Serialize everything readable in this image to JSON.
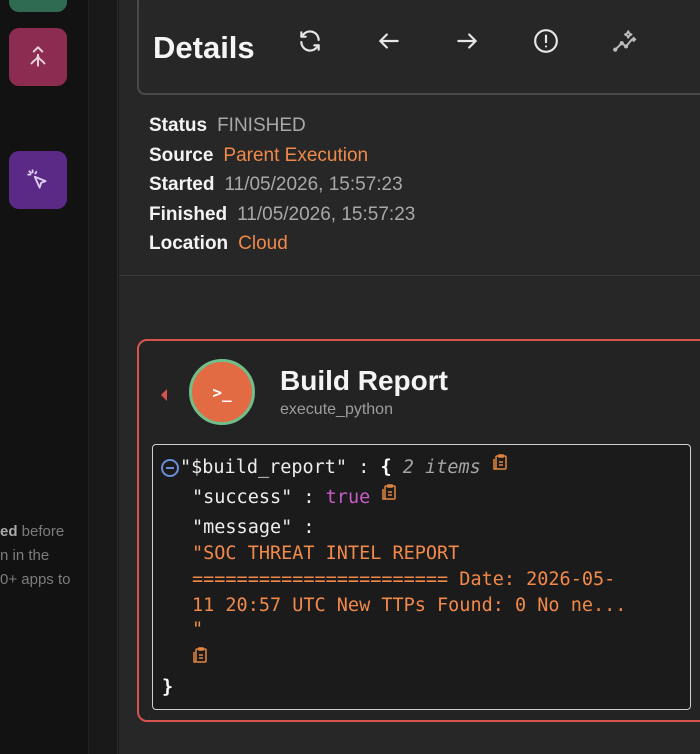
{
  "sidebar": {
    "text_bold": "ed",
    "text_lines": [
      " before",
      "n in the",
      "0+ apps to"
    ]
  },
  "details": {
    "title": "Details",
    "toolbar": {
      "icons": [
        "refresh-icon",
        "arrow-left-icon",
        "arrow-right-icon",
        "alert-circle-icon",
        "magic-chart-icon"
      ]
    },
    "meta": [
      {
        "key": "Status",
        "value": "FINISHED"
      },
      {
        "key": "Source",
        "value": "Parent Execution"
      },
      {
        "key": "Started",
        "value": "11/05/2026, 15:57:23"
      },
      {
        "key": "Finished",
        "value": "11/05/2026, 15:57:23"
      },
      {
        "key": "Location",
        "value": "Cloud"
      }
    ]
  },
  "node": {
    "title": "Build Report",
    "subtitle": "execute_python",
    "avatar_symbol": ">_",
    "json": {
      "root_key": "\"$build_report\"",
      "root_colon": ":",
      "open_brace": "{",
      "close_brace": "}",
      "count": "2 items",
      "success_key": "\"success\"",
      "success_value": "true",
      "message_key": "\"message\"",
      "colon": ":",
      "message_lines": [
        "\"SOC THREAT INTEL REPORT",
        "======================= Date: 2026-05-",
        "11 20:57 UTC New TTPs Found: 0 No ne...",
        "\""
      ]
    }
  },
  "colors": {
    "accent_orange": "#f0894a",
    "card_border_red": "#d9534f",
    "bool_purple": "#c75bc7"
  }
}
